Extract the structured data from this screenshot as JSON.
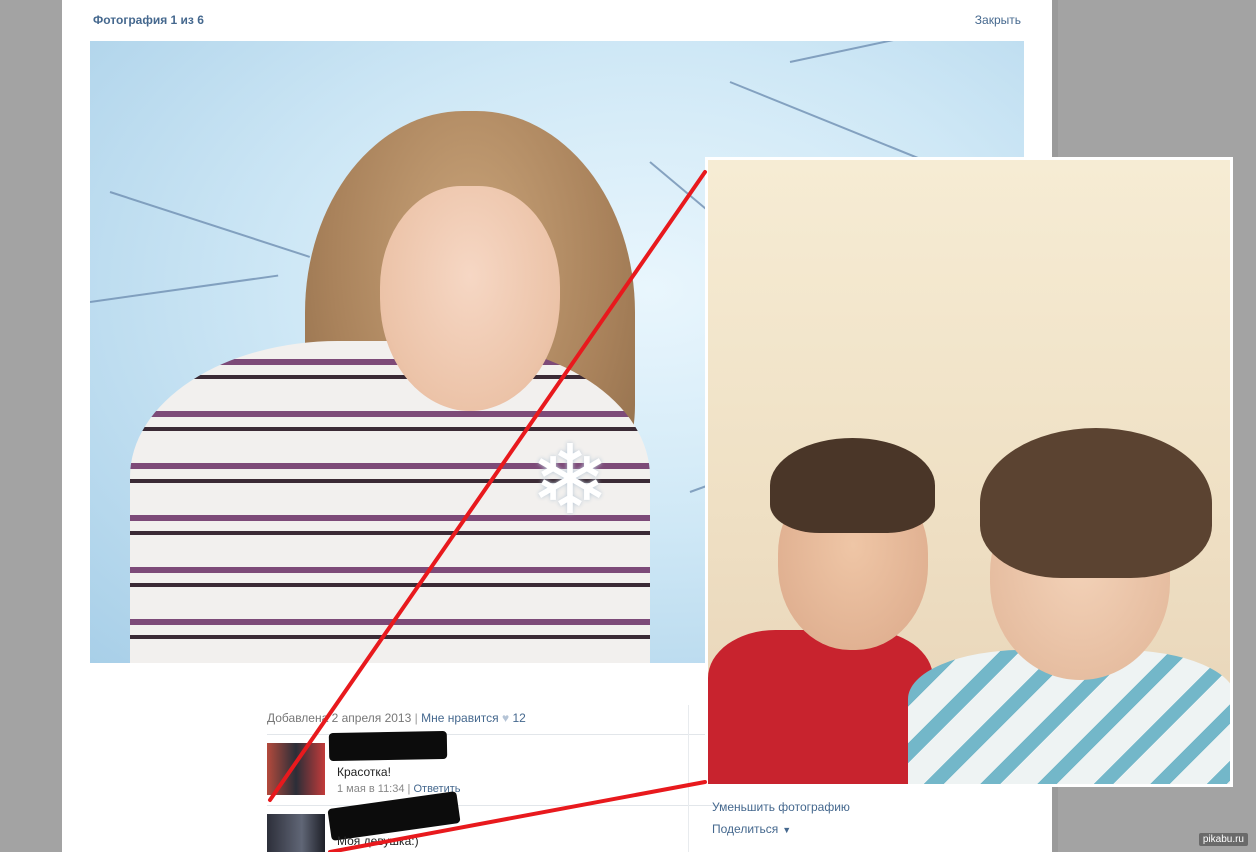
{
  "viewer": {
    "title": "Фотография 1 из 6",
    "close_label": "Закрыть"
  },
  "photo_meta": {
    "added": "Добавлена 2 апреля 2013",
    "separator": "|",
    "like_label": "Мне нравится",
    "like_count": "12"
  },
  "comments": [
    {
      "author": "",
      "text": "Красотка!",
      "date": "1 мая в 11:34",
      "reply_label": "Ответить"
    },
    {
      "author": "",
      "text": "Моя девушка:)",
      "date": "",
      "reply_label": ""
    }
  ],
  "side_actions": {
    "shrink": "Уменьшить фотографию",
    "share": "Поделиться"
  },
  "watermark": "pikabu.ru",
  "colors": {
    "link": "#45688e",
    "annotation_red": "#e8191d",
    "backdrop": "#9a9a9a"
  }
}
